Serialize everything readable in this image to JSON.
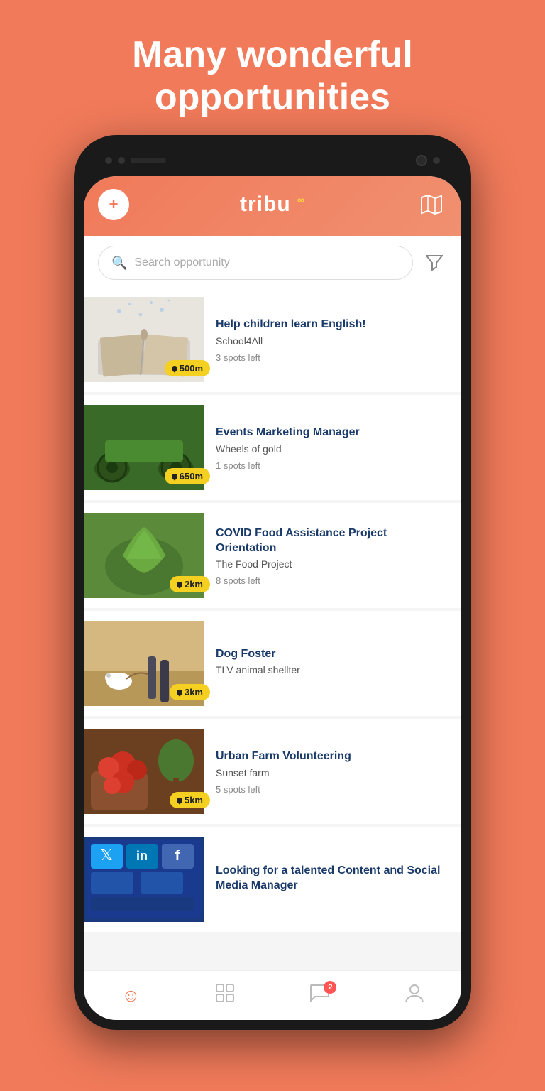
{
  "page": {
    "title_line1": "Many wonderful",
    "title_line2": "opportunities",
    "background_color": "#F07A5A"
  },
  "header": {
    "add_label": "+",
    "logo": "tribu",
    "map_aria": "map view"
  },
  "search": {
    "placeholder": "Search opportunity",
    "filter_aria": "filter"
  },
  "opportunities": [
    {
      "id": 1,
      "title": "Help children learn English!",
      "org": "School4All",
      "spots": "3 spots left",
      "distance": "500m",
      "image_class": "img-book"
    },
    {
      "id": 2,
      "title": "Events Marketing Manager",
      "org": "Wheels of gold",
      "spots": "1 spots left",
      "distance": "650m",
      "image_class": "img-wheels"
    },
    {
      "id": 3,
      "title": "COVID Food Assistance Project Orientation",
      "org": "The Food Project",
      "spots": "8 spots left",
      "distance": "2km",
      "image_class": "img-food"
    },
    {
      "id": 4,
      "title": "Dog Foster",
      "org": "TLV animal shellter",
      "spots": "",
      "distance": "3km",
      "image_class": "img-dog"
    },
    {
      "id": 5,
      "title": "Urban Farm Volunteering",
      "org": "Sunset farm",
      "spots": "5 spots left",
      "distance": "5km",
      "image_class": "img-farm"
    },
    {
      "id": 6,
      "title": "Looking for a talented Content and Social Media Manager",
      "org": "",
      "spots": "",
      "distance": "",
      "image_class": "img-social"
    }
  ],
  "bottom_nav": {
    "home_icon": "☺",
    "grid_icon": "⊞",
    "chat_icon": "💬",
    "chat_badge": "2",
    "profile_icon": "👤"
  }
}
